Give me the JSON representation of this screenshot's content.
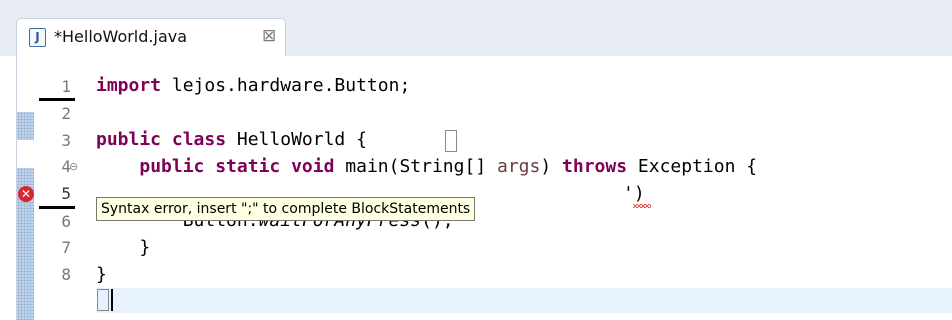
{
  "window": {
    "tab": {
      "icon": "java-file-icon",
      "icon_glyph": "J",
      "title": "*HelloWorld.java",
      "close_glyph": "⊠"
    }
  },
  "editor": {
    "line_numbers": [
      "1",
      "2",
      "3",
      "4",
      "5",
      "6",
      "7",
      "8"
    ],
    "fold_glyph": "⊖",
    "error_glyph": "✕",
    "code": {
      "line1_kw": "import",
      "line1_rest": " lejos.hardware.Button;",
      "line3_kw": "public class",
      "line3_rest": " HelloWorld ",
      "line3_brace": "{",
      "line4_indent": "    ",
      "line4_kw": "public static void",
      "line4_mid": " main(String[] ",
      "line4_param": "args",
      "line4_mid2": ") ",
      "line4_kw2": "throws",
      "line4_rest": " Exception {",
      "line5_tail": "')",
      "line6_indent": "        ",
      "line6_obj": "Button.",
      "line6_call": "waitForAnyPress",
      "line6_rest": "();",
      "line7": "    }",
      "line8": "}"
    },
    "error_tooltip": "Syntax error, insert \";\" to complete BlockStatements",
    "colors": {
      "keyword": "#7f0055",
      "parameter": "#6a3e3e",
      "error": "#d8282f",
      "tooltip_bg": "#ffffe1",
      "current_line": "#e8f2fe"
    }
  }
}
